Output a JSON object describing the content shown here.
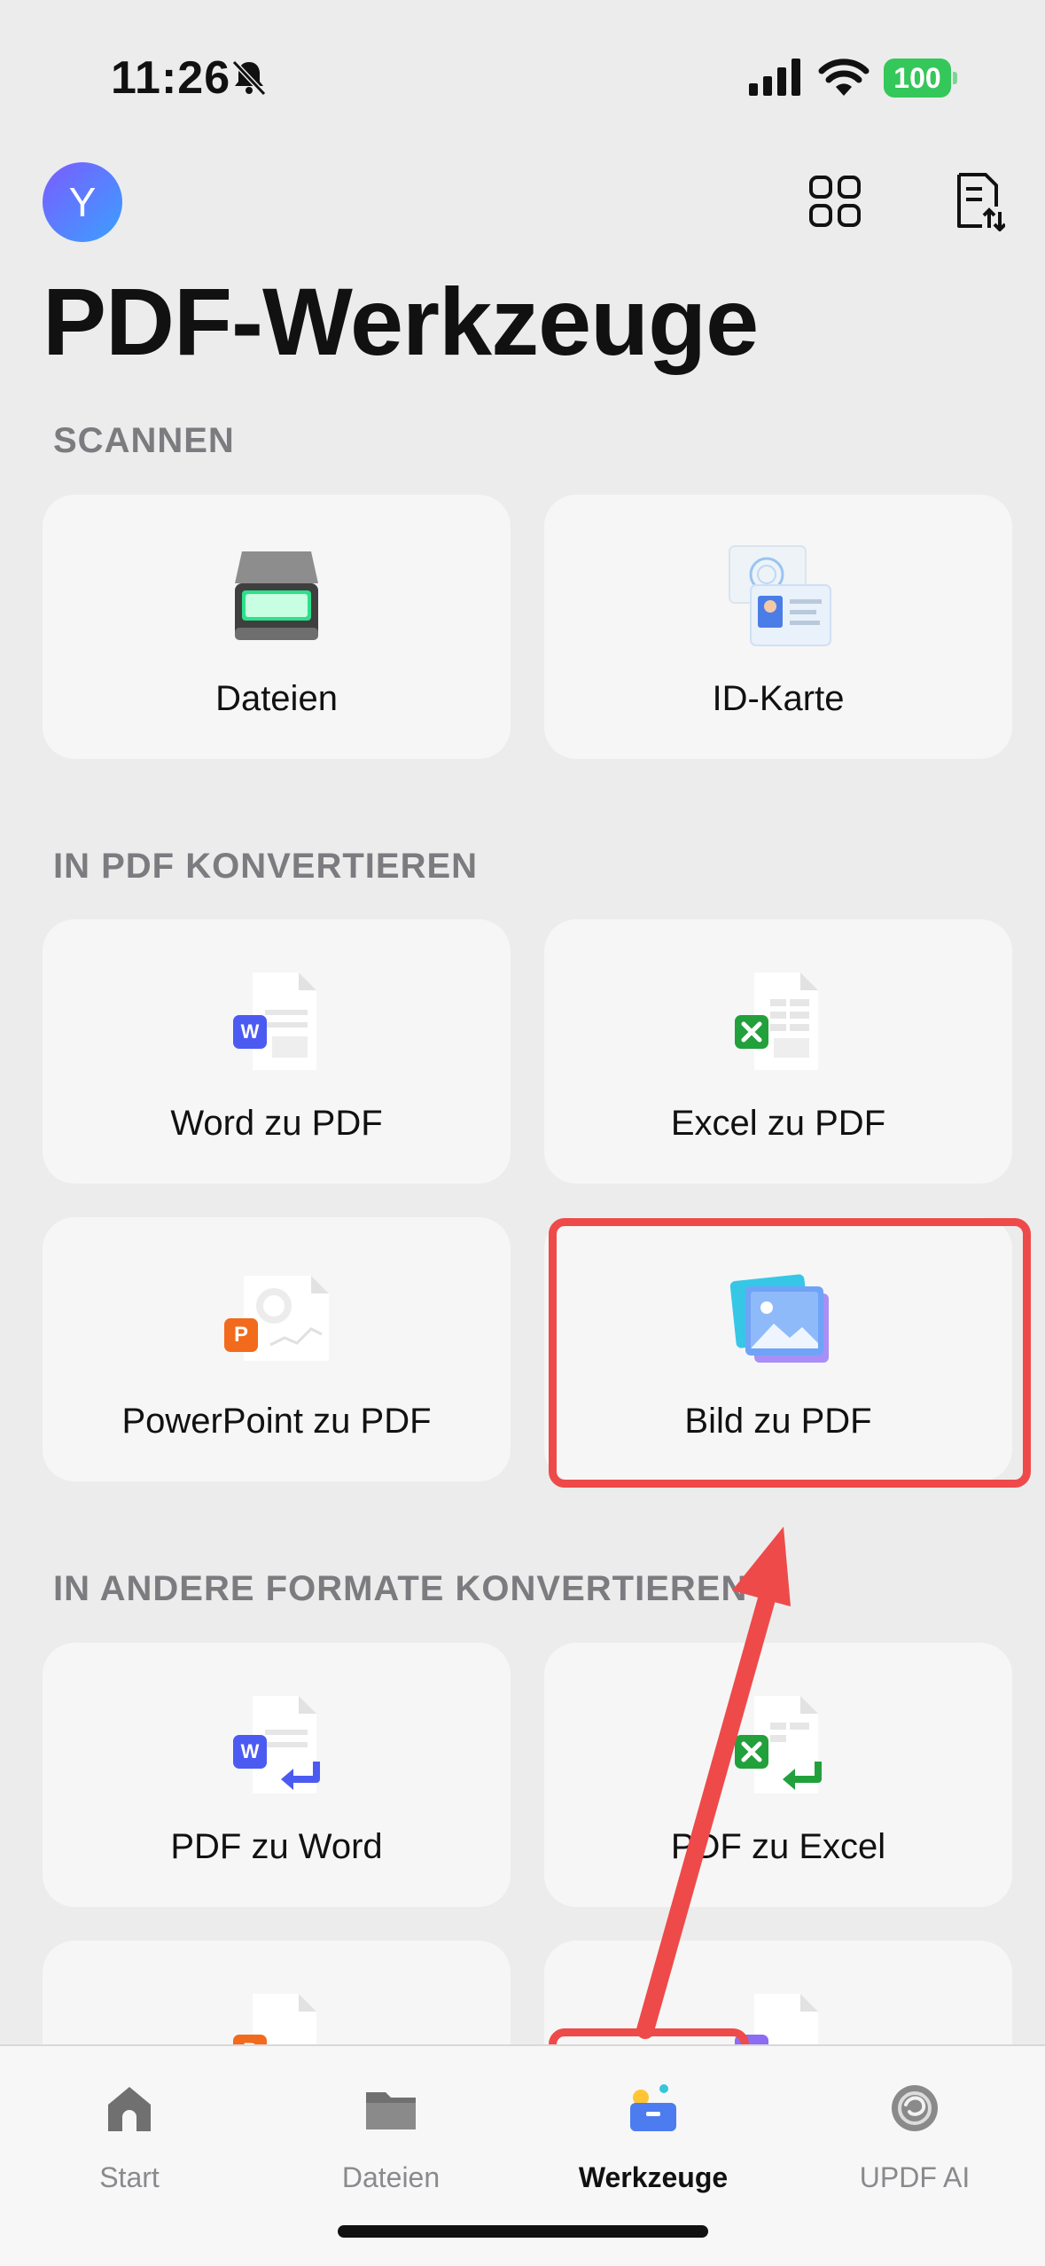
{
  "status_bar": {
    "time": "11:26",
    "battery": "100"
  },
  "header": {
    "avatar_letter": "Y",
    "title": "PDF-Werkzeuge"
  },
  "sections": [
    {
      "title": "SCANNEN",
      "items": [
        {
          "label": "Dateien",
          "icon": "scanner-icon"
        },
        {
          "label": "ID-Karte",
          "icon": "id-card-icon"
        }
      ]
    },
    {
      "title": "IN PDF KONVERTIEREN",
      "items": [
        {
          "label": "Word zu PDF",
          "icon": "word-doc-icon"
        },
        {
          "label": "Excel zu PDF",
          "icon": "excel-doc-icon"
        },
        {
          "label": "PowerPoint zu PDF",
          "icon": "powerpoint-doc-icon"
        },
        {
          "label": "Bild zu PDF",
          "icon": "image-stack-icon"
        }
      ]
    },
    {
      "title": "IN ANDERE FORMATE KONVERTIEREN",
      "items": [
        {
          "label": "PDF zu Word",
          "icon": "pdf-to-word-icon"
        },
        {
          "label": "PDF zu Excel",
          "icon": "pdf-to-excel-icon"
        }
      ]
    }
  ],
  "tabs": [
    {
      "label": "Start",
      "icon": "home-icon"
    },
    {
      "label": "Dateien",
      "icon": "folder-icon"
    },
    {
      "label": "Werkzeuge",
      "icon": "toolbox-icon",
      "active": true
    },
    {
      "label": "UPDF AI",
      "icon": "ai-icon"
    }
  ],
  "colors": {
    "accent_highlight": "#ee4a4a",
    "battery": "#34c759",
    "background": "#ececec"
  }
}
